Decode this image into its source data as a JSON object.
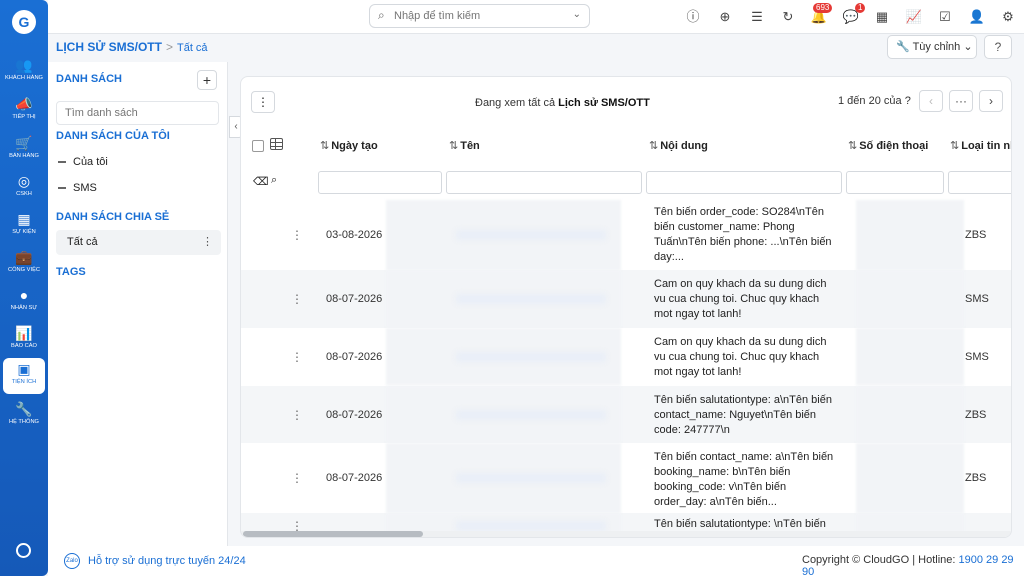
{
  "rail": {
    "items": [
      {
        "icon": "customers-icon",
        "glyph": "👥",
        "label": "KHÁCH HÀNG"
      },
      {
        "icon": "megaphone-icon",
        "glyph": "📣",
        "label": "TIẾP THỊ"
      },
      {
        "icon": "cart-icon",
        "glyph": "🛒",
        "label": "BÁN HÀNG"
      },
      {
        "icon": "support-icon",
        "glyph": "◎",
        "label": "CSKH"
      },
      {
        "icon": "calendar-icon",
        "glyph": "▦",
        "label": "SỰ KIỆN"
      },
      {
        "icon": "briefcase-icon",
        "glyph": "💼",
        "label": "CÔNG VIỆC"
      },
      {
        "icon": "person-icon",
        "glyph": "●",
        "label": "NHÂN SỰ"
      },
      {
        "icon": "report-icon",
        "glyph": "📊",
        "label": "BÁO CÁO"
      },
      {
        "icon": "utilities-icon",
        "glyph": "▣",
        "label": "TIỆN ÍCH"
      },
      {
        "icon": "wrench-icon",
        "glyph": "🔧",
        "label": "HỆ THỐNG"
      }
    ]
  },
  "topbar": {
    "search_placeholder": "Nhập để tìm kiếm",
    "notification_count": "693",
    "chat_count": "1"
  },
  "breadcrumb": {
    "title": "LỊCH SỬ SMS/OTT",
    "separator": ">",
    "current": "Tất cả"
  },
  "header_actions": {
    "customize_label": "Tùy chỉnh",
    "help_label": "?"
  },
  "panel": {
    "lists_heading": "DANH SÁCH",
    "search_placeholder": "Tìm danh sách",
    "my_lists_heading": "DANH SÁCH CỦA TÔI",
    "my_lists": [
      "Của tôi",
      "SMS"
    ],
    "shared_heading": "DANH SÁCH CHIA SẺ",
    "shared_item": "Tất cả",
    "tags_heading": "TAGS"
  },
  "table": {
    "viewing_prefix": "Đang xem tất cả",
    "viewing_name": "Lịch sử SMS/OTT",
    "pager_text": "1 đến 20 của",
    "pager_question": "?",
    "columns": [
      "Ngày tạo",
      "Tên",
      "Nội dung",
      "Số điện thoại",
      "Loại tin nh"
    ],
    "rows": [
      {
        "date": "03-08-2026",
        "content": "Tên biến order_code: SO284\\nTên biến customer_name: Phong Tuấn\\nTên biến phone: ...\\nTên biến day:...",
        "type": "ZBS"
      },
      {
        "date": "08-07-2026",
        "content": "Cam on quy khach da su dung dich vu cua chung toi. Chuc quy khach mot ngay tot lanh!",
        "type": "SMS"
      },
      {
        "date": "08-07-2026",
        "content": "Cam on quy khach da su dung dich vu cua chung toi. Chuc quy khach mot ngay tot lanh!",
        "type": "SMS"
      },
      {
        "date": "08-07-2026",
        "content": "Tên biến salutationtype: a\\nTên biến contact_name: Nguyet\\nTên biến code: 247777\\n",
        "type": "ZBS"
      },
      {
        "date": "08-07-2026",
        "content": "Tên biến contact_name: a\\nTên biến booking_name: b\\nTên biến booking_code: v\\nTên biến order_day: a\\nTên biến...",
        "type": "ZBS"
      },
      {
        "date": "",
        "content": "Tên biến salutationtype: \\nTên biến",
        "type": ""
      }
    ]
  },
  "footer": {
    "zalo_label": "Zalo",
    "support": "Hỗ trợ sử dụng trực tuyến 24/24",
    "copyright": "Copyright © CloudGO",
    "hotline_label": "| Hotline:",
    "hotline": "1900 29 29 90"
  }
}
